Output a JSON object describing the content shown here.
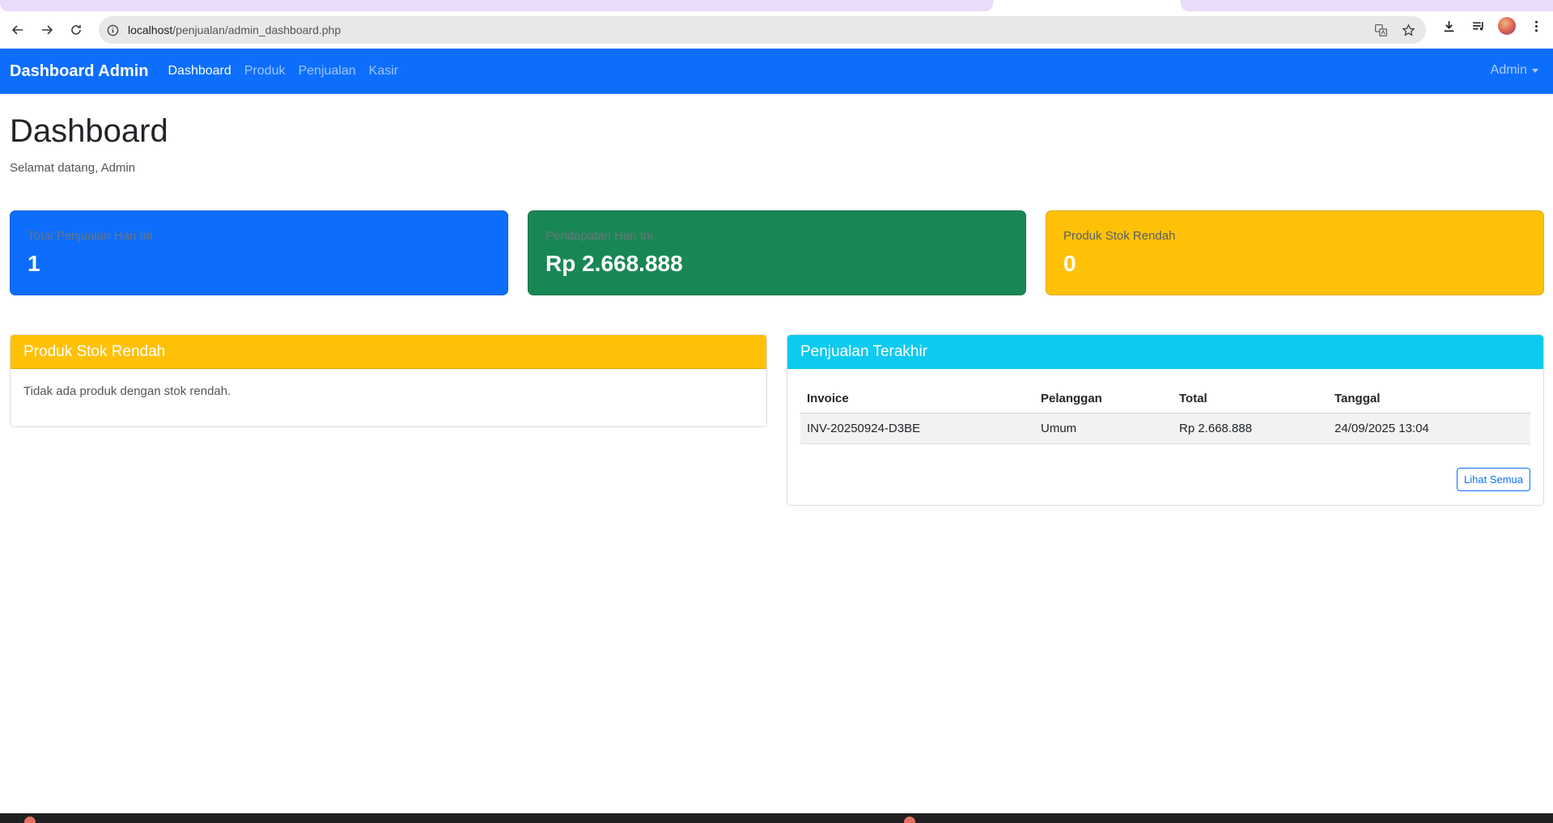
{
  "browser": {
    "url_host": "localhost",
    "url_path": "/penjualan/admin_dashboard.php"
  },
  "navbar": {
    "brand": "Dashboard Admin",
    "links": [
      "Dashboard",
      "Produk",
      "Penjualan",
      "Kasir"
    ],
    "active": "Dashboard",
    "user_menu": "Admin"
  },
  "page": {
    "title": "Dashboard",
    "welcome": "Selamat datang, Admin"
  },
  "stats": [
    {
      "label": "Total Penjualan Hari Ini",
      "value": "1",
      "color": "#0d6efd"
    },
    {
      "label": "Pendapatan Hari Ini",
      "value": "Rp 2.668.888",
      "color": "#198754"
    },
    {
      "label": "Produk Stok Rendah",
      "value": "0",
      "color": "#ffc107"
    }
  ],
  "low_stock_panel": {
    "title": "Produk Stok Rendah",
    "message": "Tidak ada produk dengan stok rendah.",
    "color": "#ffc107"
  },
  "recent_sales_panel": {
    "title": "Penjualan Terakhir",
    "color": "#0dcaf0",
    "columns": [
      "Invoice",
      "Pelanggan",
      "Total",
      "Tanggal"
    ],
    "rows": [
      [
        "INV-20250924-D3BE",
        "Umum",
        "Rp 2.668.888",
        "24/09/2025 13:04"
      ]
    ],
    "view_all": "Lihat Semua"
  }
}
